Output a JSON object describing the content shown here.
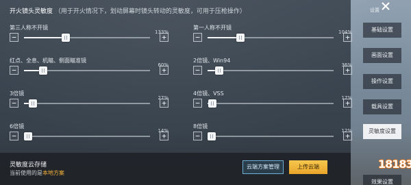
{
  "header": {
    "title": "开火镜头灵敏度",
    "description": "（用于开火情况下，划动屏幕时镜头转动的灵敏度，可用于压枪操作）"
  },
  "sliders": [
    {
      "label": "第三人称不开镜",
      "value_text": "133%",
      "level": 0.33
    },
    {
      "label": "第一人称不开镜",
      "value_text": "104%",
      "level": 0.26
    },
    {
      "label": "红点、全息、机瞄、侧面瞄准镜",
      "value_text": "60%",
      "level": 0.15
    },
    {
      "label": "2倍镜、Win94",
      "value_text": "36%",
      "level": 0.09
    },
    {
      "label": "3倍镜",
      "value_text": "27%",
      "level": 0.07
    },
    {
      "label": "4倍镜、VSS",
      "value_text": "17%",
      "level": 0.04
    },
    {
      "label": "6倍镜",
      "value_text": "14%",
      "level": 0.035
    },
    {
      "label": "8倍镜",
      "value_text": "12%",
      "level": 0.03
    }
  ],
  "buttons": {
    "minus": "−",
    "plus": "+"
  },
  "cloud": {
    "title": "灵敏度云存储",
    "current_prefix": "当前使用的是",
    "current_value": "本地方案",
    "manage_label": "云端方案管理",
    "upload_label": "上传云端"
  },
  "sidebar": {
    "header_label": "设置",
    "items": [
      {
        "label": "基础设置"
      },
      {
        "label": "画面设置"
      },
      {
        "label": "操作设置"
      },
      {
        "label": "载具设置"
      },
      {
        "label": "灵敏度设置"
      },
      {
        "label": "效果设置"
      }
    ],
    "active_index": 4
  },
  "watermark": {
    "text": "18183"
  },
  "colors": {
    "accent": "#f3b23a",
    "upload_button": "#efb43a",
    "manage_border": "#6fb0d6"
  }
}
